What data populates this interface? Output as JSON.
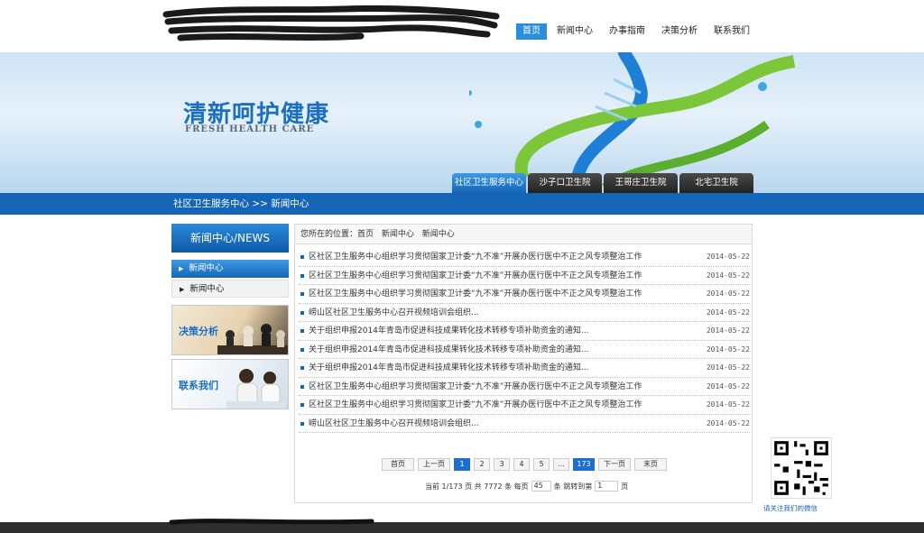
{
  "header": {
    "nav": [
      {
        "label": "首页",
        "active": true
      },
      {
        "label": "新闻中心",
        "active": false
      },
      {
        "label": "办事指南",
        "active": false
      },
      {
        "label": "决策分析",
        "active": false
      },
      {
        "label": "联系我们",
        "active": false
      }
    ]
  },
  "banner": {
    "title": "清新呵护健康",
    "subtitle": "FRESH HEALTH CARE",
    "tabs": [
      {
        "label": "社区卫生服务中心",
        "active": true
      },
      {
        "label": "沙子口卫生院",
        "active": false
      },
      {
        "label": "王哥庄卫生院",
        "active": false
      },
      {
        "label": "北宅卫生院",
        "active": false
      }
    ]
  },
  "breadcrumb": "社区卫生服务中心 >> 新闻中心",
  "sidebar": {
    "heading": "新闻中心/NEWS",
    "items": [
      {
        "label": "新闻中心",
        "active": true
      },
      {
        "label": "新闻中心",
        "active": false
      }
    ],
    "promos": [
      {
        "label": "决策分析"
      },
      {
        "label": "联系我们"
      }
    ]
  },
  "main": {
    "location_label": "您所在的位置：首页",
    "location_parts": [
      "新闻中心",
      "新闻中心"
    ],
    "news": [
      {
        "title": "区社区卫生服务中心组织学习贯彻国家卫计委“九不准”开展办医行医中不正之风专项整治工作",
        "date": "2014-05-22"
      },
      {
        "title": "区社区卫生服务中心组织学习贯彻国家卫计委“九不准”开展办医行医中不正之风专项整治工作",
        "date": "2014-05-22"
      },
      {
        "title": "区社区卫生服务中心组织学习贯彻国家卫计委“九不准”开展办医行医中不正之风专项整治工作",
        "date": "2014-05-22"
      },
      {
        "title": "崂山区社区卫生服务中心召开视频培训会组织...",
        "date": "2014-05-22"
      },
      {
        "title": "关于组织申报2014年青岛市促进科技成果转化技术转移专项补助资金的通知...",
        "date": "2014-05-22"
      },
      {
        "title": "关于组织申报2014年青岛市促进科技成果转化技术转移专项补助资金的通知...",
        "date": "2014-05-22"
      },
      {
        "title": "关于组织申报2014年青岛市促进科技成果转化技术转移专项补助资金的通知...",
        "date": "2014-05-22"
      },
      {
        "title": "区社区卫生服务中心组织学习贯彻国家卫计委“九不准”开展办医行医中不正之风专项整治工作",
        "date": "2014-05-22"
      },
      {
        "title": "区社区卫生服务中心组织学习贯彻国家卫计委“九不准”开展办医行医中不正之风专项整治工作",
        "date": "2014-05-22"
      },
      {
        "title": "崂山区社区卫生服务中心召开视频培训会组织...",
        "date": "2014-05-22"
      }
    ],
    "pager": {
      "first": "首页",
      "prev": "上一页",
      "pages": [
        "1",
        "2",
        "3",
        "4",
        "5",
        "...",
        "173"
      ],
      "current": "1",
      "next": "下一页",
      "last": "末页",
      "status_prefix": "当前 1/173 页 共 7772 条 每页",
      "per_page": "45",
      "status_mid": "条 跳转到第",
      "jump_value": "1",
      "status_suffix": "页"
    }
  },
  "qr": {
    "caption": "请关注我们的微信"
  },
  "colors": {
    "primary_blue": "#1565b7",
    "accent_blue": "#2a8fd8",
    "dark_tab": "#2e2e2e"
  }
}
